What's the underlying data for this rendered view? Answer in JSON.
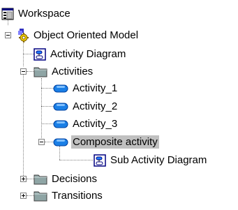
{
  "tree": {
    "root": {
      "label": "Workspace",
      "icon": "workspace-icon"
    },
    "model": {
      "label": "Object Oriented Model",
      "icon": "model-icon",
      "expanded": true
    },
    "items": [
      {
        "label": "Activity Diagram",
        "icon": "diagram-icon"
      },
      {
        "label": "Activities",
        "icon": "folder-icon",
        "expanded": true
      },
      {
        "label": "Activity_1",
        "icon": "activity-icon"
      },
      {
        "label": "Activity_2",
        "icon": "activity-icon"
      },
      {
        "label": "Activity_3",
        "icon": "activity-icon"
      },
      {
        "label": "Composite activity",
        "icon": "activity-icon",
        "expanded": true,
        "selected": true
      },
      {
        "label": "Sub Activity Diagram",
        "icon": "diagram-icon"
      },
      {
        "label": "Decisions",
        "icon": "folder-icon",
        "expanded": false
      },
      {
        "label": "Transitions",
        "icon": "folder-icon",
        "expanded": false
      }
    ]
  },
  "colors": {
    "selection": "#c0c0c0",
    "activity": "#1a7fe6",
    "folder": "#8fa5a5",
    "model": "#f0d000"
  }
}
